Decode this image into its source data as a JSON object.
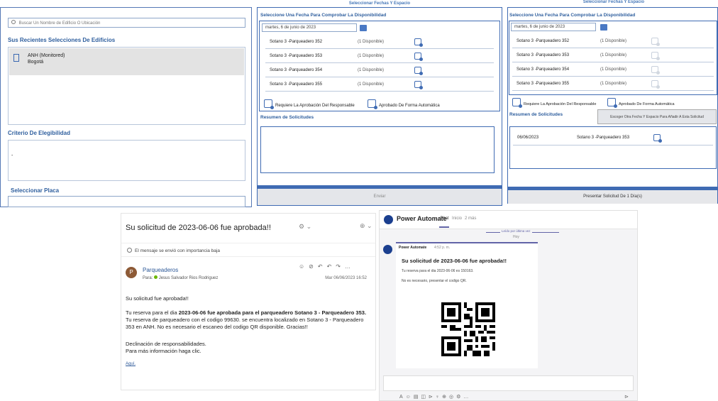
{
  "panel1": {
    "search_placeholder": "Buscar Un Nombre de Edificio O Ubicación",
    "recent_title": "Sus Recientes Selecciones De Edificios",
    "building_name": "ANH (Monitored)",
    "building_city": "Bogotá",
    "criteria_title": "Criterio De Elegibilidad",
    "criteria_value": "-",
    "plate_title": "Seleccionar Placa"
  },
  "panel2": {
    "banner": "Seleccionar Fechas Y Espacio",
    "heading": "Seleccione Una Fecha Para Comprobar La Disponibilidad",
    "date": "martes, 6 de junio de 2023",
    "rows": [
      {
        "name": "Sotano 3 -Parqueadero 352",
        "avail": "(1 Disponible)"
      },
      {
        "name": "Sotano 3 -Parqueadero 353",
        "avail": "(1 Disponible)"
      },
      {
        "name": "Sotano 3 -Parqueadero 354",
        "avail": "(1 Disponible)"
      },
      {
        "name": "Sotano 3 -Parqueadero 355",
        "avail": "(1 Disponible)"
      }
    ],
    "legend_approval": "Requiere La Aprobación Del Responsable",
    "legend_auto": "Aprobado De Forma Automática",
    "summary_title": "Resumen de Solicitudes",
    "send_button": "Enviar"
  },
  "panel3": {
    "banner": "Seleccionar Fechas Y Espacio",
    "heading": "Seleccione Una Fecha Para Comprobar La Disponibilidad",
    "date": "martes, 6 de junio de 2023",
    "rows": [
      {
        "name": "Sotano 3 -Parqueadero 352",
        "avail": "(1 Disponible)"
      },
      {
        "name": "Sotano 3 -Parqueadero 353",
        "avail": "(1 Disponible)"
      },
      {
        "name": "Sotano 3 -Parqueadero 354",
        "avail": "(1 Disponible)"
      },
      {
        "name": "Sotano 3 -Parqueadero 355",
        "avail": "(1 Disponible)"
      }
    ],
    "legend_approval": "Requiere La Aprobación Del Responsable",
    "legend_auto": "Aprobado De Forma Automática",
    "summary_title": "Resumen de Solicitudes",
    "add_button": "Escoger Otra Fecha Y Espacio Para Añadir A Esta Solicitud",
    "summary_row": {
      "date": "06/06/2023",
      "space": "Sotano 3 -Parqueadero 353"
    },
    "submit_button": "Presentar Solicitud De 1 Día(s)"
  },
  "email": {
    "subject": "Su solicitud de 2023-06-06 fue aprobada!!",
    "importance": "El mensaje se envió con importancia baja",
    "avatar_letter": "P",
    "sender": "Parqueaderos",
    "to_label": "Para:",
    "to_name": "Jesus Salvador Rios Rodriguez",
    "date": "Mar 06/06/2023 16:52",
    "body_line1": "Su solicitud fue aprobada!!",
    "body_p2_prefix": "Tu reserva para el dia ",
    "body_p2_bold": "2023-06-06 fue aprobada para el parqueadero Sotano 3 - Parqueadero 353.",
    "body_p3": "Tu reserva de parqueadero con el codigo 99630. se encuentra localizado en Sotano 3 - Parqueadero 353 en ANH. No es necesario el escaneo del codigo QR disponible. Gracias!!",
    "body_p4a": "Declinación de responsabilidades.",
    "body_p4b": "Para más información haga clic.",
    "link": "Aquí."
  },
  "teams": {
    "app_name": "Power Automate",
    "tab_chat": "Chat",
    "tab_inicio": "Inicio",
    "tab_more": "2 más",
    "divider": "Leído por última vez",
    "today": "Hoy",
    "sender": "Power Automate",
    "time": "4:52 p. m.",
    "card_title": "Su solicitud de 2023-06-06 fue aprobada!!",
    "card_line1": "Tu reserva para el dia 2023-06-06 es 150163.",
    "card_line2": "No es necesario, presentar el codigo QR."
  },
  "colors": {
    "accent": "#3f6bb3",
    "title_blue": "#2f5f9e"
  }
}
